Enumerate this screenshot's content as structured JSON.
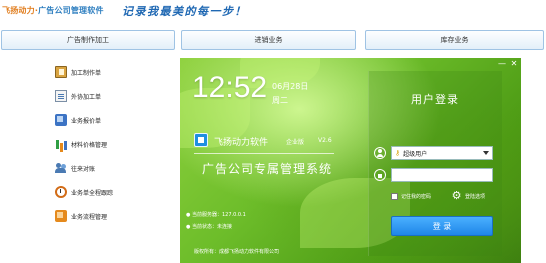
{
  "header": {
    "brand_main": "飞扬动力",
    "brand_sub": "广告公司管理软件",
    "slogan": "记录我最美的每一步！"
  },
  "sections": {
    "production": "广告制作加工",
    "purchase": "进销业务",
    "inventory": "库存业务"
  },
  "menu": {
    "items": [
      {
        "label": "加工制作单",
        "icon": "book-icon"
      },
      {
        "label": "外协加工单",
        "icon": "document-icon"
      },
      {
        "label": "业务报价单",
        "icon": "quote-icon"
      },
      {
        "label": "材料价格管理",
        "icon": "bar-chart-icon"
      },
      {
        "label": "往来对账",
        "icon": "people-icon"
      },
      {
        "label": "业务单全程跟踪",
        "icon": "clock-icon"
      },
      {
        "label": "业务流程管理",
        "icon": "flow-icon"
      }
    ]
  },
  "login_window": {
    "minimize": "—",
    "close": "✕",
    "time": "12:52",
    "date": "06月28日",
    "weekday": "周二",
    "product_name": "飞扬动力软件",
    "edition": "企业版",
    "version": "V2.6",
    "system_title": "广告公司专属管理系统",
    "server_line": "● 当前服务器：127.0.0.1",
    "status_line": "● 当前状态：未连接",
    "copyright": "版权所有：成都飞扬动力软件有限公司",
    "panel_title": "用户登录",
    "user_select_value": "超级用户",
    "password_value": "",
    "remember_label": "记住我的密码",
    "settings_label": "登陆选项",
    "login_button": "登 录",
    "colors": {
      "accent_blue": "#1f86e8",
      "background_green": "#6dbd2a"
    }
  }
}
